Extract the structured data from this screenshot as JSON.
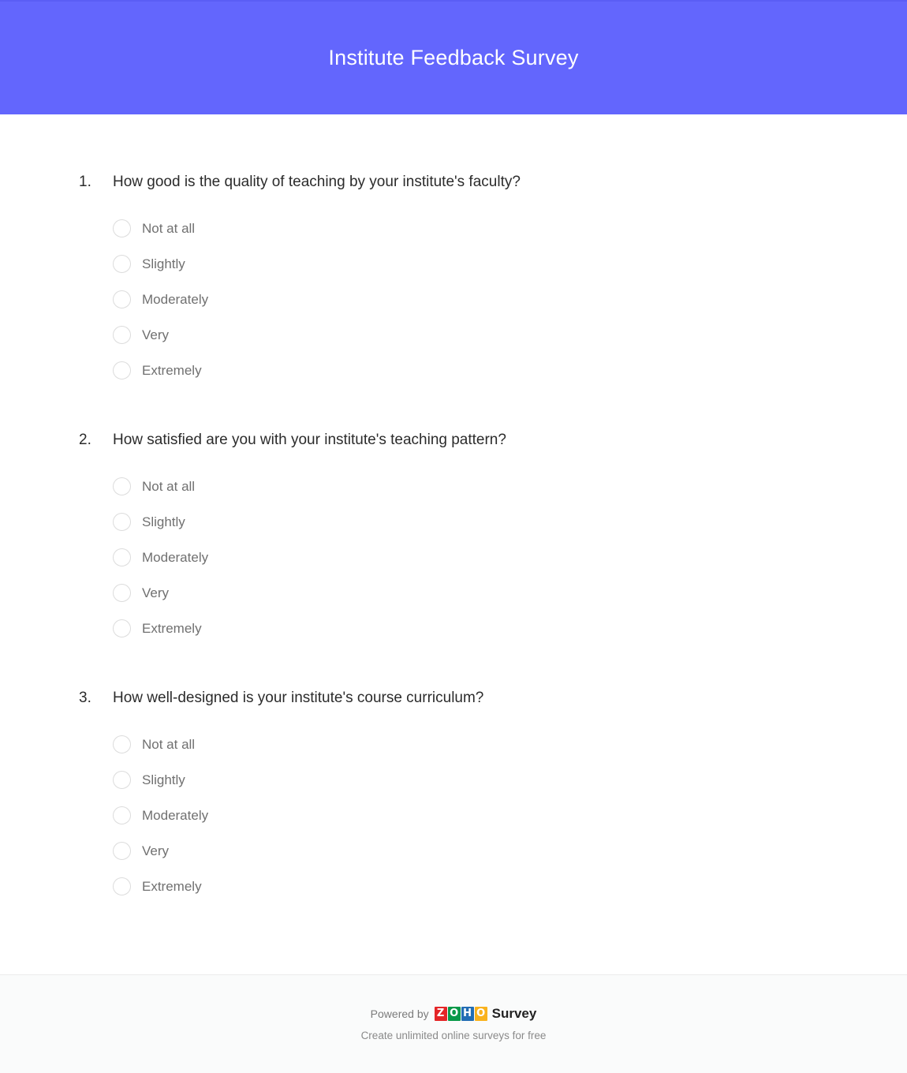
{
  "header": {
    "title": "Institute Feedback Survey",
    "background_color": "#6366fd",
    "text_color": "#ffffff"
  },
  "questions": [
    {
      "number": "1.",
      "text": "How good is the quality of teaching by your institute's faculty?",
      "options": [
        "Not at all",
        "Slightly",
        "Moderately",
        "Very",
        "Extremely"
      ]
    },
    {
      "number": "2.",
      "text": "How satisfied are you with your institute's teaching pattern?",
      "options": [
        "Not at all",
        "Slightly",
        "Moderately",
        "Very",
        "Extremely"
      ]
    },
    {
      "number": "3.",
      "text": "How well-designed is your institute's course curriculum?",
      "options": [
        "Not at all",
        "Slightly",
        "Moderately",
        "Very",
        "Extremely"
      ]
    }
  ],
  "footer": {
    "powered_by": "Powered by",
    "brand_word": "Survey",
    "tagline": "Create unlimited online surveys for free",
    "logo_letters": [
      "Z",
      "O",
      "H",
      "O"
    ],
    "logo_colors": [
      "#e42527",
      "#089949",
      "#226db4",
      "#f9b21d"
    ]
  }
}
